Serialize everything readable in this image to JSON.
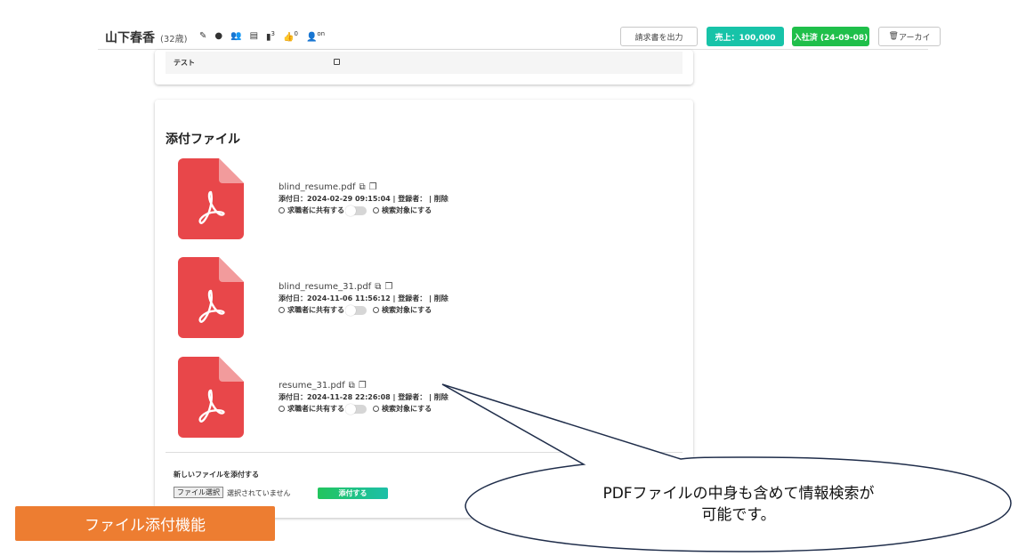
{
  "header": {
    "name": "山下春香",
    "age": "(32歳)",
    "icon_badge_1": "3",
    "icon_badge_2": "0",
    "icon_badge_3": "on",
    "invoice_button": "請求書を出力",
    "sales_button": "売上：100,000",
    "joined_button": "入社済 (24-09-08)",
    "archive_button": "アーカイ"
  },
  "top_card": {
    "test_label": "テスト"
  },
  "attachments": {
    "title": "添付ファイル",
    "files": [
      {
        "name": "blind_resume.pdf",
        "meta": "添付日：2024-02-29 09:15:04 | 登録者： | 削除",
        "share_label": "求職者に共有する",
        "search_label": "検索対象にする"
      },
      {
        "name": "blind_resume_31.pdf",
        "meta": "添付日：2024-11-06 11:56:12 | 登録者： | 削除",
        "share_label": "求職者に共有する",
        "search_label": "検索対象にする"
      },
      {
        "name": "resume_31.pdf",
        "meta": "添付日：2024-11-28 22:26:08 | 登録者： | 削除",
        "share_label": "求職者に共有する",
        "search_label": "検索対象にする"
      }
    ],
    "new_file_label": "新しいファイルを添付する",
    "choose_file_button": "ファイル選択",
    "no_file_text": "選択されていません",
    "attach_button": "添付する"
  },
  "annotation": {
    "feature_label": "ファイル添付機能",
    "callout_line1": "PDFファイルの中身も含めて情報検索が",
    "callout_line2": "可能です。"
  },
  "colors": {
    "pdf_red": "#e8474a",
    "green": "#00c853",
    "teal": "#17c3b2",
    "orange": "#ed7d31"
  }
}
